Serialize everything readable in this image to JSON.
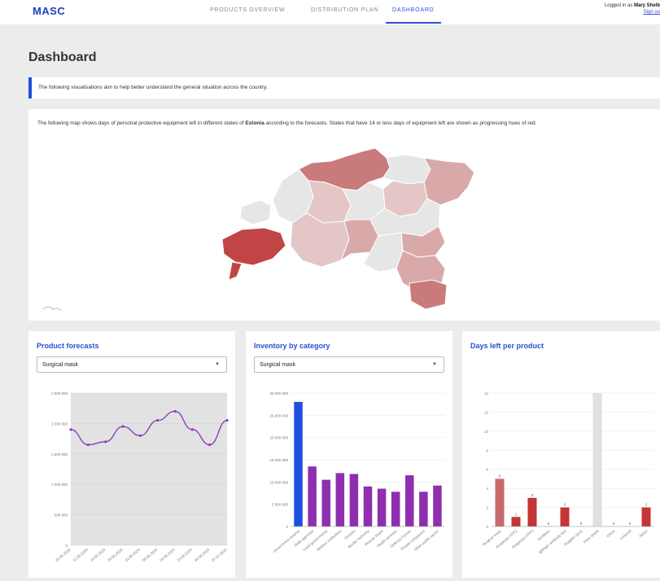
{
  "header": {
    "logo": "MASC",
    "nav": [
      {
        "label": "PRODUCTS OVERVIEW",
        "active": false
      },
      {
        "label": "DISTRIBUTION PLAN",
        "active": false
      },
      {
        "label": "DASHBOARD",
        "active": true
      }
    ],
    "user_prefix": "Logged in as",
    "user_name": "Mary Shelb",
    "signout": "Sign ou"
  },
  "page": {
    "title": "Dashboard",
    "info": "The following visualisations aim to help better understand the general situation across the country."
  },
  "map": {
    "desc_before": "The following map shows days of personal protective equipment left in different states of",
    "country": "Estonia",
    "desc_after": "according to the forecasts. States that have 14 or less days of equipment left are shown as progressing hues of red.",
    "colors": {
      "grey": "#e6e6e6",
      "light": "#e4c6c6",
      "mid": "#d9a9a9",
      "strong": "#c97a7a",
      "dark": "#c24545"
    }
  },
  "cards": {
    "forecasts": {
      "title": "Product forecasts",
      "selected": "Surgical mask"
    },
    "inventory": {
      "title": "Inventory by category",
      "selected": "Surgical mask"
    },
    "days": {
      "title": "Days left per product"
    }
  },
  "chart_data": [
    {
      "type": "area",
      "x": [
        "05.05.2020",
        "12.05.2020",
        "19.05.2020",
        "26.05.2020",
        "02.06.2020",
        "09.06.2020",
        "16.06.2020",
        "23.06.2020",
        "30.06.2020",
        "07.07.2020"
      ],
      "y": [
        1900000,
        1650000,
        1700000,
        1950000,
        1800000,
        2050000,
        2200000,
        1900000,
        1650000,
        2050000
      ],
      "yticks": [
        "0",
        "500 000",
        "1 000 000",
        "1 500 000",
        "2 000 000",
        "2 500 000"
      ],
      "ylim": [
        0,
        2500000
      ],
      "colors": {
        "line": "#8e3fb8",
        "fill": "#e2e2e2"
      }
    },
    {
      "type": "bar",
      "categories": [
        "Government reserve",
        "State agencies",
        "Local governments",
        "Welfare institutions",
        "Doctors",
        "Border Authority",
        "Rescue board",
        "Health services",
        "Defence Forces",
        "Private companies",
        "Other public sector"
      ],
      "values": [
        28000000,
        13500000,
        10500000,
        12000000,
        11800000,
        9000000,
        8500000,
        7800000,
        11500000,
        7800000,
        9200000
      ],
      "yticks": [
        "0",
        "5 000 000",
        "10 000 000",
        "15 000 000",
        "20 000 000",
        "25 000 000",
        "30 000 000"
      ],
      "ylim": [
        0,
        30000000
      ],
      "colors": {
        "first": "#1f4fe0",
        "rest": "#8e2fb0"
      }
    },
    {
      "type": "bar",
      "categories": [
        "Surgical mask",
        "Respirator FFP2",
        "Respirator FFP3",
        "Ventilator",
        "IgM/IgG antibody test",
        "Goggles (pcs)",
        "Face shield",
        "Glove",
        "Coverall",
        "Apron"
      ],
      "values": [
        5,
        1,
        3,
        0,
        2,
        0,
        0,
        0,
        0,
        2
      ],
      "labels": [
        "5",
        "1",
        "3",
        "0",
        "2",
        "0",
        "",
        "0",
        "0",
        "2"
      ],
      "yticks": [
        "0",
        "2",
        "4",
        "6",
        "8",
        "10",
        "12",
        "14"
      ],
      "ylim": [
        0,
        14
      ],
      "highlight_index": 6,
      "colors": {
        "first": "#c86a6a",
        "rest": "#c43535",
        "highlight": "#e0e0e0"
      }
    }
  ]
}
